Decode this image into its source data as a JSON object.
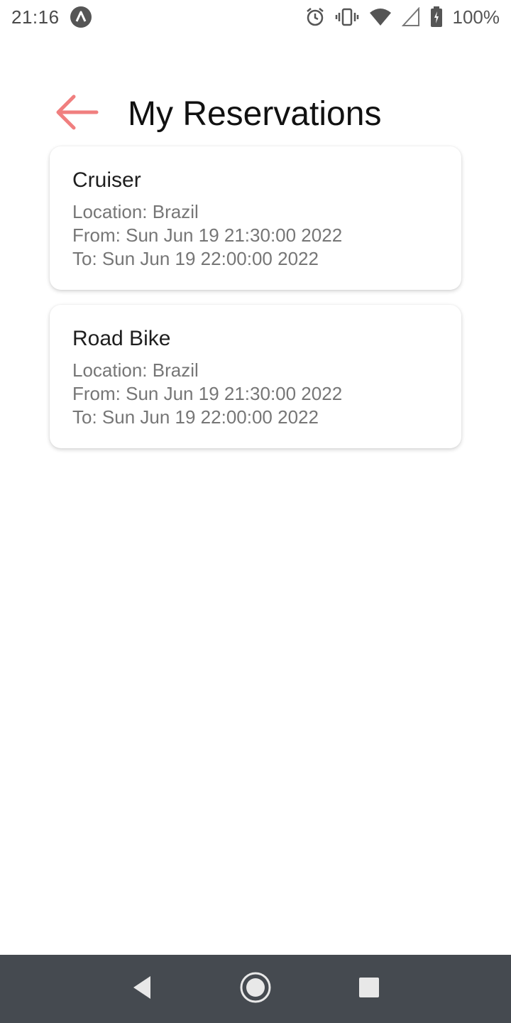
{
  "status_bar": {
    "time": "21:16",
    "battery_percent": "100%",
    "icons": [
      "app-a-icon",
      "alarm-icon",
      "vibrate-icon",
      "wifi-icon",
      "signal-icon",
      "battery-charging-icon"
    ]
  },
  "header": {
    "title": "My Reservations",
    "back_icon": "arrow-left-icon",
    "accent_color": "#f07f7f"
  },
  "reservations": [
    {
      "name": "Cruiser",
      "location": "Location: Brazil",
      "from": "From: Sun Jun 19 21:30:00 2022",
      "to": "To: Sun Jun 19 22:00:00 2022"
    },
    {
      "name": "Road Bike",
      "location": "Location: Brazil",
      "from": "From: Sun Jun 19 21:30:00 2022",
      "to": "To: Sun Jun 19 22:00:00 2022"
    }
  ],
  "nav_bar": {
    "icons": [
      "nav-back-icon",
      "nav-home-icon",
      "nav-recents-icon"
    ],
    "background": "#454a50"
  }
}
